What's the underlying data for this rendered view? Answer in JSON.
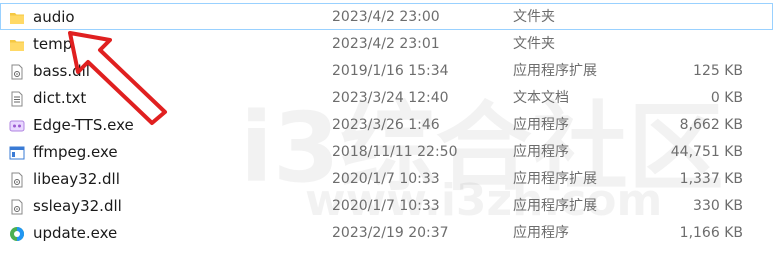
{
  "files": [
    {
      "name": "audio",
      "date": "2023/4/2 23:00",
      "type": "文件夹",
      "size": "",
      "icon": "folder-icon"
    },
    {
      "name": "temp",
      "date": "2023/4/2 23:01",
      "type": "文件夹",
      "size": "",
      "icon": "folder-icon"
    },
    {
      "name": "bass.dll",
      "date": "2019/1/16 15:34",
      "type": "应用程序扩展",
      "size": "125 KB",
      "icon": "dll-file-icon"
    },
    {
      "name": "dict.txt",
      "date": "2023/3/24 12:40",
      "type": "文本文档",
      "size": "0 KB",
      "icon": "text-file-icon"
    },
    {
      "name": "Edge-TTS.exe",
      "date": "2023/3/26 1:46",
      "type": "应用程序",
      "size": "8,662 KB",
      "icon": "edge-tts-app-icon"
    },
    {
      "name": "ffmpeg.exe",
      "date": "2018/11/11 22:50",
      "type": "应用程序",
      "size": "44,751 KB",
      "icon": "exe-window-icon"
    },
    {
      "name": "libeay32.dll",
      "date": "2020/1/7 10:33",
      "type": "应用程序扩展",
      "size": "1,337 KB",
      "icon": "dll-file-icon"
    },
    {
      "name": "ssleay32.dll",
      "date": "2020/1/7 10:33",
      "type": "应用程序扩展",
      "size": "330 KB",
      "icon": "dll-file-icon"
    },
    {
      "name": "update.exe",
      "date": "2023/2/19 20:37",
      "type": "应用程序",
      "size": "1,166 KB",
      "icon": "update-app-icon"
    }
  ],
  "watermark": {
    "text": "i3综合社区",
    "url": "www.i3zh.com"
  },
  "colors": {
    "selection_border": "#99d1ff",
    "folder": "#f5c842",
    "annotation_arrow": "#e02020",
    "secondary_text": "#6d6d6d"
  }
}
